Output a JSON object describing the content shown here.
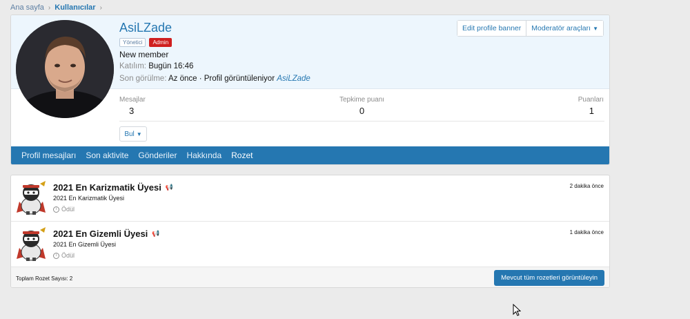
{
  "breadcrumb": {
    "home": "Ana sayfa",
    "current": "Kullanıcılar"
  },
  "profile": {
    "username": "AsiLZade",
    "role_badge": "Yönetici",
    "admin_badge": "Admin",
    "user_title": "New member",
    "joined_label": "Katılım:",
    "joined_value": "Bugün 16:46",
    "last_seen_label": "Son görülme:",
    "last_seen_value": "Az önce · Profil görüntüleniyor",
    "last_seen_link": "AsiLZade",
    "edit_banner_label": "Edit profile banner",
    "mod_tools_label": "Moderatör araçları",
    "stats": [
      {
        "label": "Mesajlar",
        "value": "3"
      },
      {
        "label": "Tepkime puanı",
        "value": "0"
      },
      {
        "label": "Puanları",
        "value": "1"
      }
    ],
    "find_label": "Bul"
  },
  "tabs": [
    "Profil mesajları",
    "Son aktivite",
    "Gönderiler",
    "Hakkında",
    "Rozet"
  ],
  "active_tab": "Rozet",
  "badges": [
    {
      "title": "2021 En Karizmatik Üyesi",
      "desc": "2021 En Karizmatik Üyesi",
      "type": "Ödül",
      "time": "2 dakika önce"
    },
    {
      "title": "2021 En Gizemli Üyesi",
      "desc": "2021 En Gizemli Üyesi",
      "type": "Ödül",
      "time": "1 dakika önce"
    }
  ],
  "footer": {
    "total": "Toplam Rozet Sayısı: 2",
    "view_all": "Mevcut tüm rozetleri görüntüleyin"
  },
  "colors": {
    "accent": "#2577b1",
    "header_bg": "#edf6fd",
    "admin_red": "#cf1f1f"
  }
}
